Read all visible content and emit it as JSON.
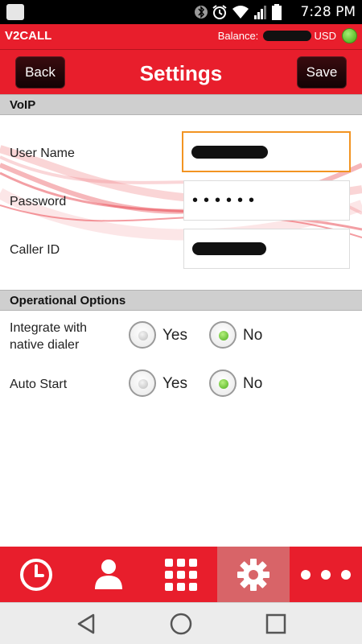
{
  "status_bar": {
    "time": "7:28 PM",
    "icons": [
      "app-notification-icon",
      "bluetooth-icon",
      "alarm-icon",
      "wifi-icon",
      "signal-icon",
      "battery-icon"
    ]
  },
  "app_bar": {
    "title": "V2CALL",
    "balance_label": "Balance:",
    "balance_currency": "USD",
    "status_color": "#5dbb2a"
  },
  "header": {
    "back_label": "Back",
    "title": "Settings",
    "save_label": "Save"
  },
  "voip": {
    "section_title": "VoIP",
    "fields": [
      {
        "label": "User Name",
        "value": ""
      },
      {
        "label": "Password",
        "value": "••••••"
      },
      {
        "label": "Caller ID",
        "value": ""
      }
    ]
  },
  "operational": {
    "section_title": "Operational Options",
    "options": [
      {
        "label": "Integrate with native dialer",
        "yes_label": "Yes",
        "no_label": "No",
        "selected": "No"
      },
      {
        "label": "Auto Start",
        "yes_label": "Yes",
        "no_label": "No",
        "selected": "No"
      }
    ]
  },
  "tab_bar": {
    "tabs": [
      "recents-icon",
      "contacts-icon",
      "dialpad-icon",
      "settings-icon",
      "more-icon"
    ],
    "active": "settings-icon"
  },
  "colors": {
    "brand_red": "#e81e2c",
    "focus_orange": "#f29422",
    "selected_green": "#4cae1d"
  }
}
